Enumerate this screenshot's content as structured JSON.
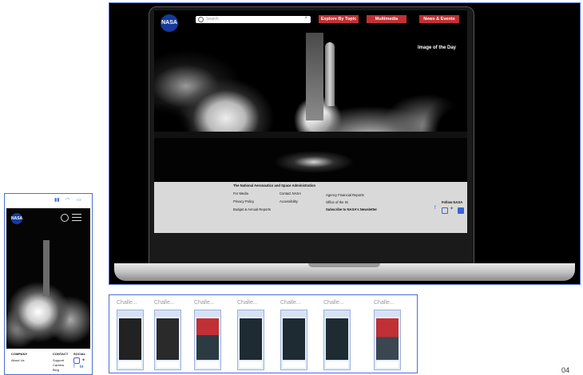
{
  "phone": {
    "logo": "NASA",
    "status_icons": [
      "signal-icon",
      "wifi-icon",
      "battery-icon"
    ],
    "footer": {
      "company_heading": "COMPANY",
      "company_items": [
        "About Us"
      ],
      "contact_heading": "CONTACT",
      "contact_items": [
        "Support",
        "Careers",
        "Blog"
      ],
      "social_heading": "SOCIAL"
    }
  },
  "laptop": {
    "logo": "NASA",
    "search": {
      "placeholder": "Search",
      "clear": "×"
    },
    "nav": [
      "Explore By Topic",
      "Multimedia",
      "News & Events"
    ],
    "hero_caption": "Image of the Day",
    "footer": {
      "org": "The National Aeronautics and Space Administration",
      "col1": [
        "For Media",
        "Privacy Policy",
        "Budget & Annual Reports"
      ],
      "col2": [
        "Contact NASA",
        "Accessibility"
      ],
      "col3": [
        "Agency Financial Reports",
        "Office of the IG",
        "Subscribe to NASA's Newsletter"
      ],
      "follow": "Follow NASA"
    }
  },
  "challenges": {
    "labels": [
      "Challe...",
      "Challe...",
      "Challe...",
      "Challe...",
      "Challe...",
      "Challe...",
      "Challe..."
    ]
  },
  "page_number": "04",
  "colors": {
    "accent_red": "#c03034",
    "nasa_blue": "#163a9b",
    "frame_blue": "#4a6fd6"
  }
}
